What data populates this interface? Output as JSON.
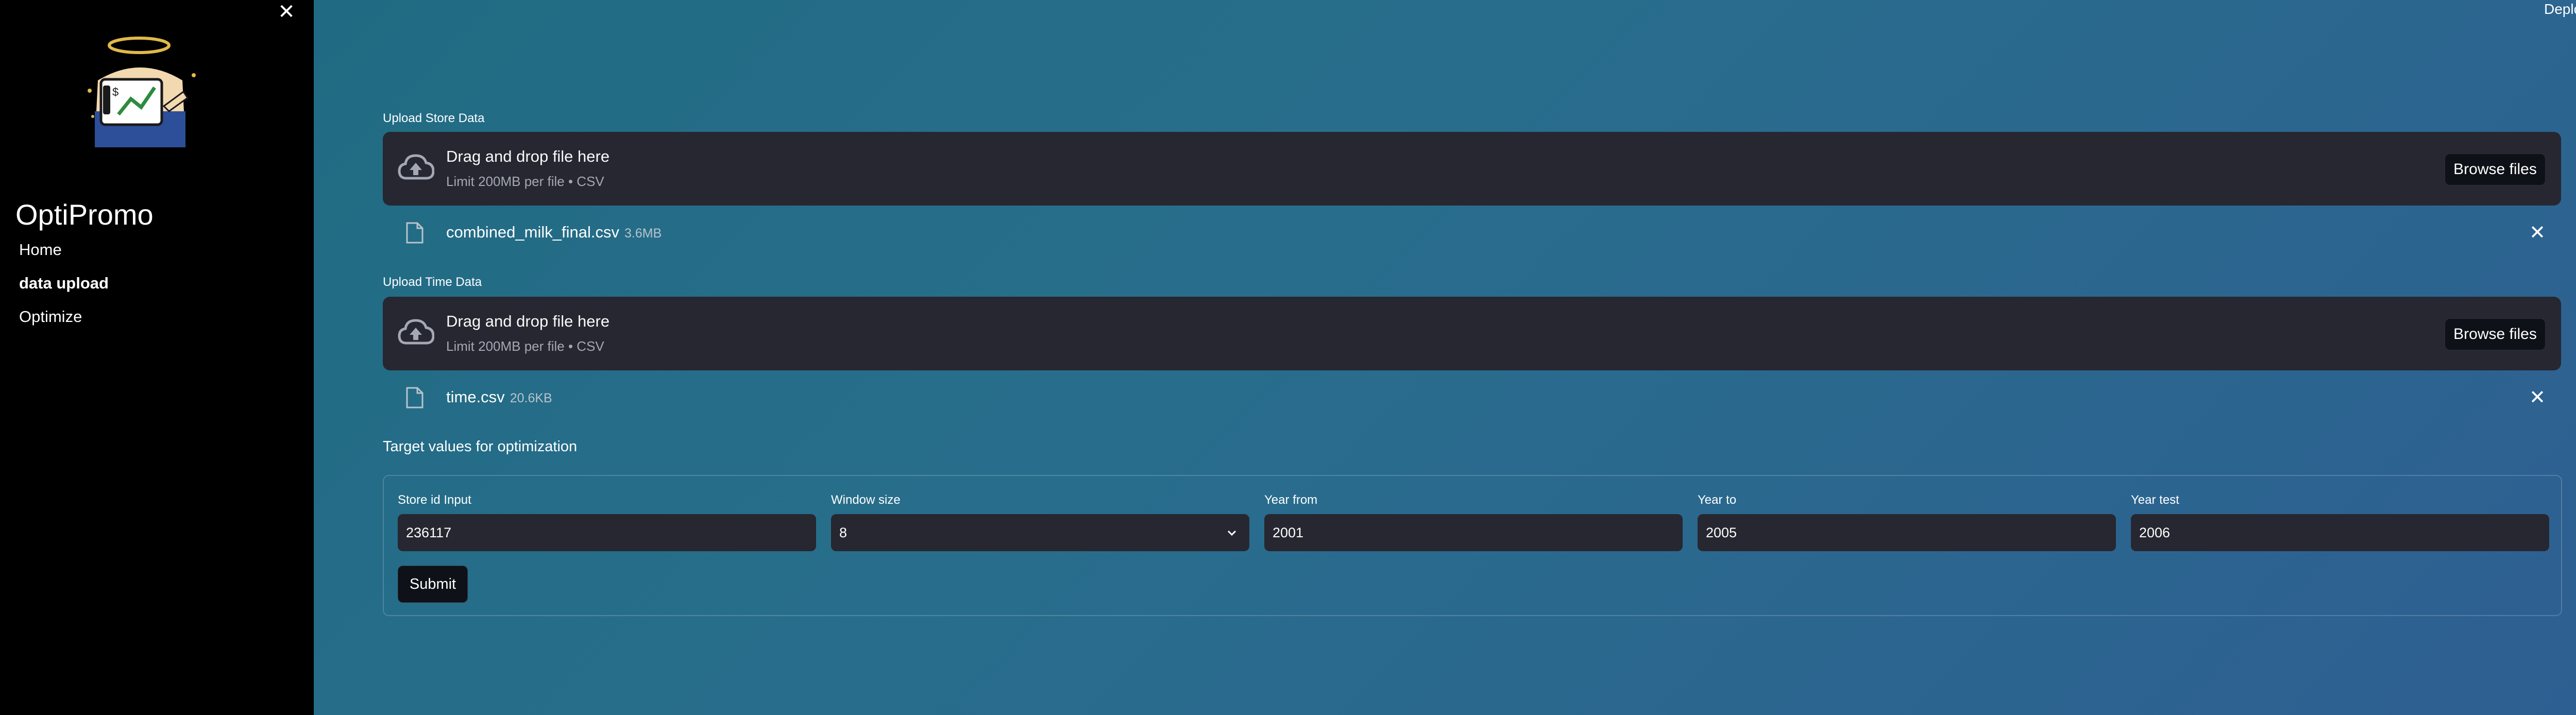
{
  "sidebar": {
    "app_name": "OptiPromo",
    "nav": [
      {
        "label": "Home",
        "active": false
      },
      {
        "label": "data upload",
        "active": true
      },
      {
        "label": "Optimize",
        "active": false
      }
    ]
  },
  "header": {
    "deploy_label": "Deploy"
  },
  "uploads": [
    {
      "label": "Upload Store Data",
      "drop_title": "Drag and drop file here",
      "drop_sub": "Limit 200MB per file • CSV",
      "browse_label": "Browse files",
      "file": {
        "name": "combined_milk_final.csv",
        "size": "3.6MB"
      }
    },
    {
      "label": "Upload Time Data",
      "drop_title": "Drag and drop file here",
      "drop_sub": "Limit 200MB per file • CSV",
      "browse_label": "Browse files",
      "file": {
        "name": "time.csv",
        "size": "20.6KB"
      }
    }
  ],
  "form": {
    "title": "Target values for optimization",
    "fields": [
      {
        "label": "Store id Input",
        "value": "236117"
      },
      {
        "label": "Window size",
        "value": "8"
      },
      {
        "label": "Year from",
        "value": "2001"
      },
      {
        "label": "Year to",
        "value": "2005"
      },
      {
        "label": "Year test",
        "value": "2006"
      }
    ],
    "submit_label": "Submit"
  },
  "icons": {
    "close": "close-icon",
    "cloud_upload": "cloud-upload-icon",
    "file": "file-icon",
    "chevron": "chevron-down-icon",
    "menu": "kebab-menu-icon"
  },
  "colors": {
    "sidebar_bg": "#000000",
    "panel_bg": "#262730",
    "button_bg": "#0e1117",
    "main_gradient_start": "#1e6a80",
    "main_gradient_end": "#2e5f92"
  }
}
